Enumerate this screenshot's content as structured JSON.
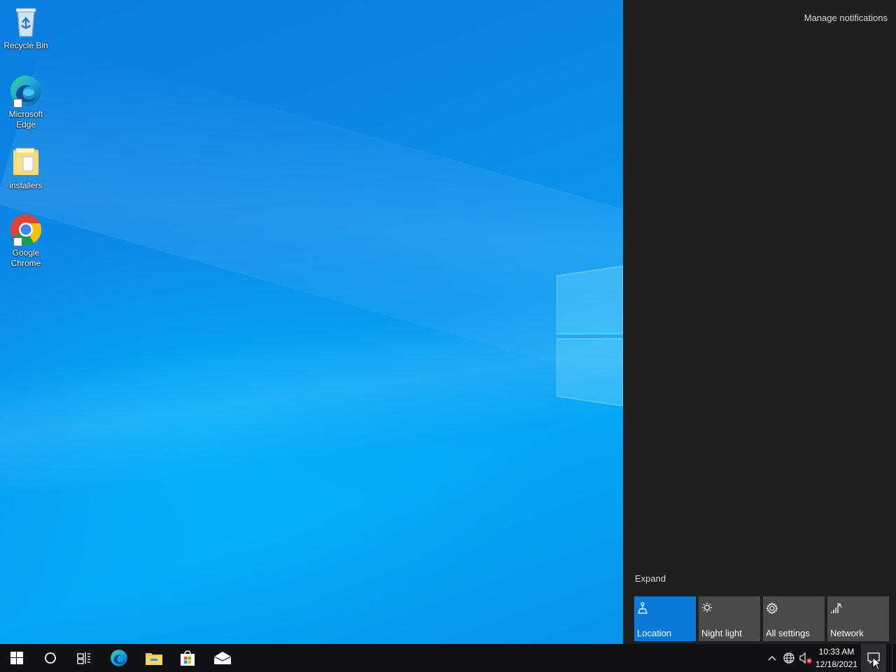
{
  "desktop": {
    "icons": [
      {
        "label": "Recycle Bin",
        "icon": "recycle-bin-icon"
      },
      {
        "label": "Microsoft Edge",
        "icon": "edge-icon"
      },
      {
        "label": "installers",
        "icon": "folder-icon"
      },
      {
        "label": "Google Chrome",
        "icon": "chrome-icon"
      }
    ]
  },
  "action_center": {
    "manage_notifications": "Manage notifications",
    "expand": "Expand",
    "quick_actions": [
      {
        "label": "Location",
        "icon": "location-icon",
        "active": true
      },
      {
        "label": "Night light",
        "icon": "night-light-icon",
        "active": false
      },
      {
        "label": "All settings",
        "icon": "gear-icon",
        "active": false
      },
      {
        "label": "Network",
        "icon": "network-icon",
        "active": false
      }
    ],
    "accent_color": "#0a78d7"
  },
  "taskbar": {
    "pinned": [
      "start-icon",
      "search-icon",
      "task-view-icon",
      "edge-icon",
      "file-explorer-icon",
      "store-icon",
      "mail-icon"
    ],
    "tray": [
      "show-hidden-icons",
      "network-globe-icon",
      "volume-muted-icon"
    ],
    "time": "10:33 AM",
    "date": "12/18/2021"
  }
}
